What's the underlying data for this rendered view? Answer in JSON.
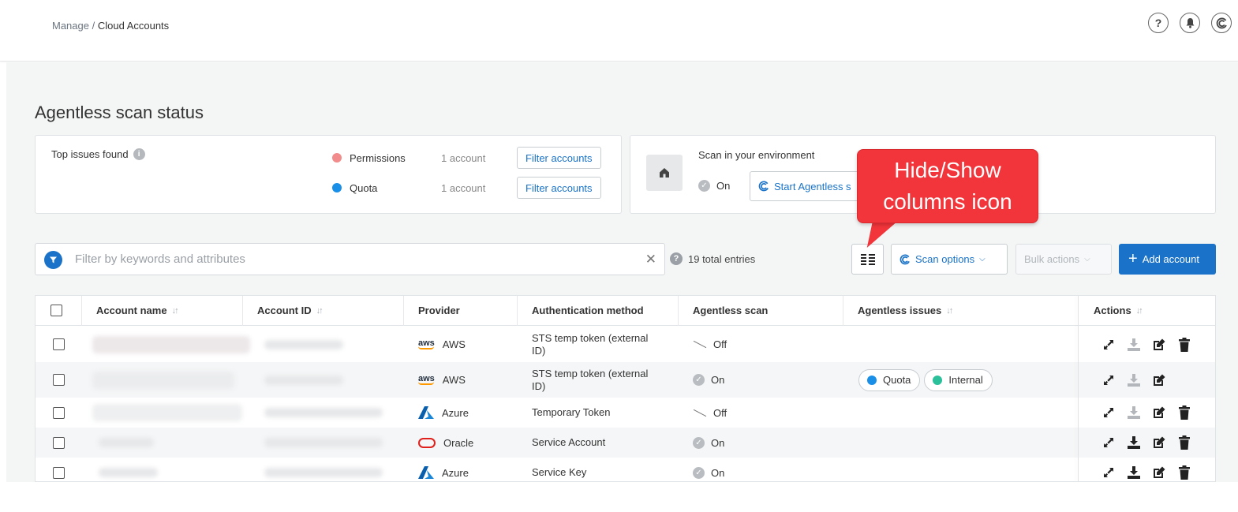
{
  "breadcrumb": {
    "parent": "Manage",
    "separator": " / ",
    "current": "Cloud Accounts"
  },
  "header_icons": [
    "help-icon",
    "notification-bell-icon",
    "brand-logo-icon"
  ],
  "page": {
    "title": "Agentless scan status"
  },
  "issues_card": {
    "title": "Top issues found",
    "rows": [
      {
        "name": "Permissions",
        "count": "1 account",
        "button": "Filter accounts",
        "color": "#f28b8b"
      },
      {
        "name": "Quota",
        "count": "1 account",
        "button": "Filter accounts",
        "color": "#1a8fe8"
      }
    ]
  },
  "scan_card": {
    "label": "Scan in your environment",
    "state": "On",
    "button": "Start Agentless s"
  },
  "filter": {
    "placeholder": "Filter by keywords and attributes",
    "total_entries": "19 total entries"
  },
  "toolbar": {
    "scan_options": "Scan options",
    "bulk_actions": "Bulk actions",
    "add_account": "Add account"
  },
  "callout": {
    "line1": "Hide/Show",
    "line2": "columns icon"
  },
  "table": {
    "columns": [
      "Account name",
      "Account ID",
      "Provider",
      "Authentication method",
      "Agentless scan",
      "Agentless issues",
      "Actions"
    ],
    "rows": [
      {
        "provider": "AWS",
        "auth_line1": "STS temp token (external",
        "auth_line2": "ID)",
        "scan": "Off",
        "issues": [],
        "delete": true,
        "download_enabled": false
      },
      {
        "provider": "AWS",
        "auth_line1": "STS temp token (external",
        "auth_line2": "ID)",
        "scan": "On",
        "issues": [
          {
            "label": "Quota",
            "color": "#1a8fe8"
          },
          {
            "label": "Internal",
            "color": "#2bbf9a"
          }
        ],
        "delete": false,
        "download_enabled": false
      },
      {
        "provider": "Azure",
        "auth_line1": "Temporary Token",
        "auth_line2": "",
        "scan": "Off",
        "issues": [],
        "delete": true,
        "download_enabled": false
      },
      {
        "provider": "Oracle",
        "auth_line1": "Service Account",
        "auth_line2": "",
        "scan": "On",
        "issues": [],
        "delete": true,
        "download_enabled": true
      },
      {
        "provider": "Azure",
        "auth_line1": "Service Key",
        "auth_line2": "",
        "scan": "On",
        "issues": [],
        "delete": true,
        "download_enabled": true
      }
    ]
  },
  "colors": {
    "accent": "#1a73c8",
    "callout": "#f2353a"
  }
}
